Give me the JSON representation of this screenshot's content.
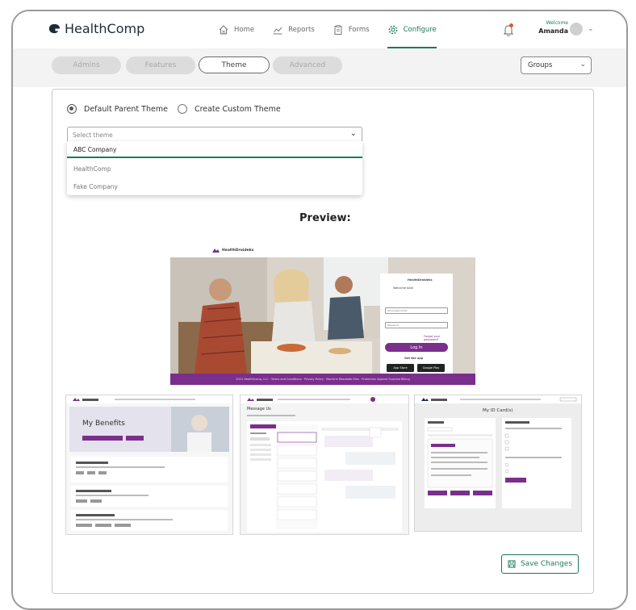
{
  "header": {
    "brand": "HealthComp",
    "nav": [
      {
        "label": "Home",
        "icon": "home-icon"
      },
      {
        "label": "Reports",
        "icon": "chart-icon"
      },
      {
        "label": "Forms",
        "icon": "clipboard-icon"
      },
      {
        "label": "Configure",
        "icon": "gear-icon",
        "active": true
      }
    ],
    "welcome_label": "Welcome",
    "user_name": "Amanda"
  },
  "tabs": [
    {
      "label": "Admins"
    },
    {
      "label": "Features"
    },
    {
      "label": "Theme",
      "active": true
    },
    {
      "label": "Advanced"
    }
  ],
  "groups_select": {
    "value": "Groups"
  },
  "theme_options": {
    "default_label": "Default Parent Theme",
    "custom_label": "Create Custom Theme",
    "selected": "default"
  },
  "theme_select": {
    "placeholder": "Select theme",
    "options": [
      "ABC Company",
      "HealthComp",
      "Fake Company"
    ],
    "selected": "ABC Company"
  },
  "preview": {
    "title": "Preview:",
    "login": {
      "brand": "HealthDroideks",
      "welcome": "Welcome back",
      "username": "AmandaSchmitz",
      "password": "Password",
      "forgot": "Forgot your password?",
      "login_button": "Log In",
      "get_app": "Get the app",
      "app_store": "App Store",
      "google_play": "Google Play"
    },
    "footer": "2021 HealthComp, LLC · Terms and Conditions · Privacy Policy · Machine Readable Files · Protection Against Surprise Billing",
    "thumb_benefits_title": "My Benefits",
    "thumb_messages_title": "Message Us",
    "thumb_idcard_title": "My ID Card(s)"
  },
  "actions": {
    "save_label": "Save Changes"
  },
  "colors": {
    "accent": "#1b7a5a",
    "preview_brand": "#7a2f8c"
  }
}
